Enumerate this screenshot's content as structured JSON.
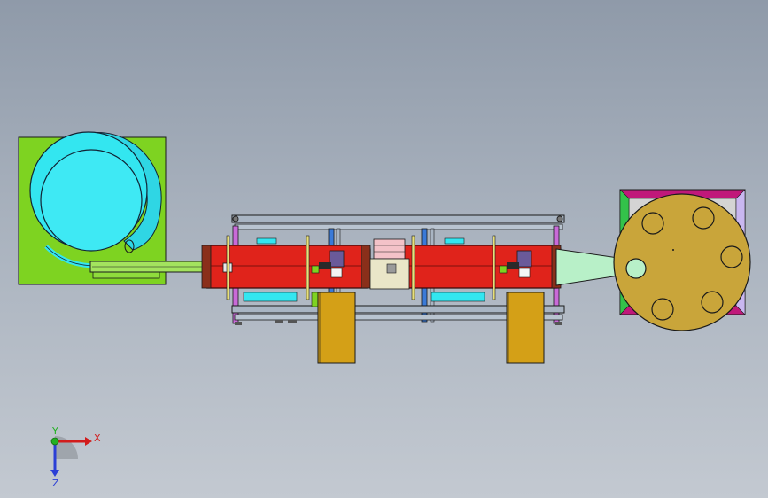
{
  "viewport": {
    "background_top": "#8f9aa9",
    "background_bottom": "#c3c9d1"
  },
  "model": {
    "components": {
      "vibratory_bowl_base": {
        "color": "#7ed321"
      },
      "vibratory_bowl": {
        "color": "#33e6f0"
      },
      "frame": {
        "color": "#a9b5c3"
      },
      "conveyor_rail": {
        "color": "#e0231b"
      },
      "legs": {
        "color": "#d4a017"
      },
      "hopper_funnel": {
        "color": "#b8f0c8"
      },
      "rotary_table": {
        "color": "#c9a53a",
        "hole_count": 6
      },
      "rotary_table_frame": {
        "color": "#c0187a"
      }
    }
  },
  "triad": {
    "x_label": "X",
    "y_label": "Y",
    "z_label": "Z",
    "x_color": "#d21c1c",
    "y_color": "#22b022",
    "z_color": "#2b3fd6"
  }
}
